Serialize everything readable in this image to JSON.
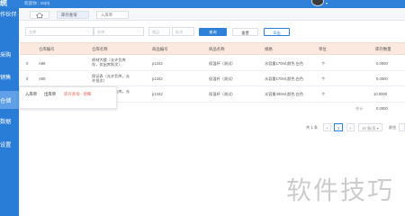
{
  "header": {
    "brand": "统",
    "hint": "欢迎你 : 18(0)"
  },
  "sidebar": {
    "items": [
      {
        "label": "作伙伴"
      },
      {
        "label": "采购"
      },
      {
        "label": "销售"
      },
      {
        "label": "仓储"
      },
      {
        "label": "数据"
      },
      {
        "label": "设置"
      }
    ]
  },
  "tabs": [
    {
      "label": "库存查询"
    },
    {
      "label": "入库单"
    }
  ],
  "filters": {
    "f1": "仓库",
    "f2": "仓库",
    "f3": "商品",
    "f4": "批次"
  },
  "buttons": {
    "search": "查询",
    "reset": "重置",
    "export": "导出"
  },
  "table": {
    "headers": [
      "仓库编号",
      "仓库名称",
      "商品编号",
      "商品名称",
      "规格",
      "单位",
      "库存数量"
    ],
    "rows": [
      {
        "sel": "0",
        "code": "A86",
        "name": "原材大楼（允许负库存，仅出库批次）",
        "sku": "p1342",
        "product": "保温杯（测试）",
        "spec": "水容量170ml,颜色:白色",
        "unit": "个",
        "qty": "0.0000"
      },
      {
        "sel": "0",
        "code": "A86",
        "name": "保证表（允许负库，允许批次）",
        "sku": "p1342",
        "product": "保温杯（测试）",
        "spec": "水容量170ml,颜色:白色",
        "unit": "个",
        "qty": "0.0000"
      },
      {
        "sel": "0",
        "code": "",
        "name": "主仓库（允许负库，允许批次）",
        "sku": "p1342",
        "product": "保温杯（测试）",
        "spec": "水容量400ml,颜色:白色",
        "unit": "个",
        "qty": "10.0000"
      }
    ],
    "total_label": "合计",
    "total_qty": "0.0000"
  },
  "popover": {
    "items": [
      "入库单",
      "出库单",
      "库存查询 · 明细"
    ]
  },
  "pagination": {
    "total": "共 1 条",
    "prev": "<",
    "current": "1",
    "next": ">",
    "page_size": "10 条/页",
    "goto": "前往"
  },
  "watermark": "软件技巧"
}
